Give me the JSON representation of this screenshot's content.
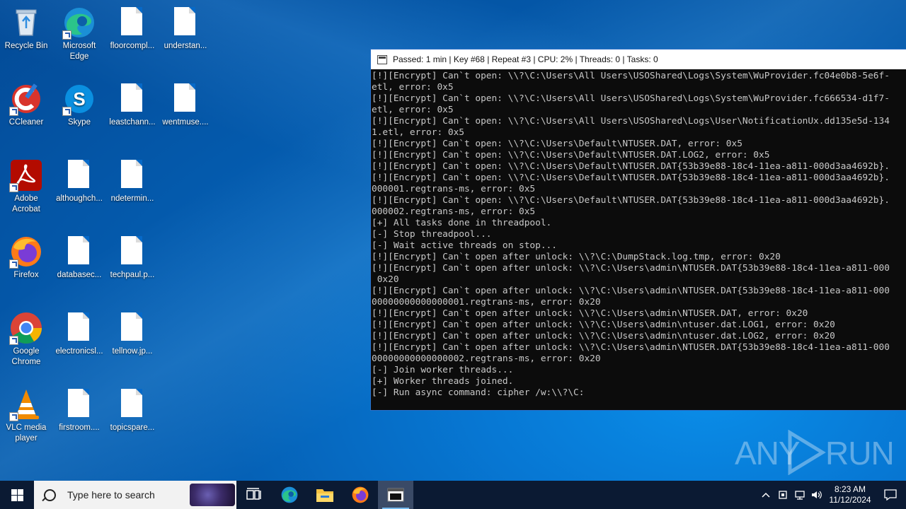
{
  "desktop": {
    "icons": [
      {
        "label": "Recycle Bin"
      },
      {
        "label": "Microsoft Edge"
      },
      {
        "label": "floorcompl..."
      },
      {
        "label": "understan..."
      },
      {
        "label": "CCleaner"
      },
      {
        "label": "Skype"
      },
      {
        "label": "leastchann..."
      },
      {
        "label": "wentmuse...."
      },
      {
        "label": "Adobe Acrobat"
      },
      {
        "label": "althoughch..."
      },
      {
        "label": "ndetermin..."
      },
      {
        "label": "Firefox"
      },
      {
        "label": "databasec..."
      },
      {
        "label": "techpaul.p..."
      },
      {
        "label": "Google Chrome"
      },
      {
        "label": "electronicsl..."
      },
      {
        "label": "tellnow.jp..."
      },
      {
        "label": "VLC media player"
      },
      {
        "label": "firstroom...."
      },
      {
        "label": "topicspare..."
      }
    ]
  },
  "console": {
    "title": "Passed: 1 min | Key #68 | Repeat #3 | CPU: 2% | Threads: 0 | Tasks: 0",
    "lines": [
      "[!][Encrypt] Can`t open: \\\\?\\C:\\Users\\All Users\\USOShared\\Logs\\System\\WuProvider.fc04e0b8-5e6f-",
      "etl, error: 0x5",
      "[!][Encrypt] Can`t open: \\\\?\\C:\\Users\\All Users\\USOShared\\Logs\\System\\WuProvider.fc666534-d1f7-",
      "etl, error: 0x5",
      "[!][Encrypt] Can`t open: \\\\?\\C:\\Users\\All Users\\USOShared\\Logs\\User\\NotificationUx.dd135e5d-134",
      "1.etl, error: 0x5",
      "[!][Encrypt] Can`t open: \\\\?\\C:\\Users\\Default\\NTUSER.DAT, error: 0x5",
      "[!][Encrypt] Can`t open: \\\\?\\C:\\Users\\Default\\NTUSER.DAT.LOG2, error: 0x5",
      "[!][Encrypt] Can`t open: \\\\?\\C:\\Users\\Default\\NTUSER.DAT{53b39e88-18c4-11ea-a811-000d3aa4692b}.",
      "[!][Encrypt] Can`t open: \\\\?\\C:\\Users\\Default\\NTUSER.DAT{53b39e88-18c4-11ea-a811-000d3aa4692b}.",
      "000001.regtrans-ms, error: 0x5",
      "[!][Encrypt] Can`t open: \\\\?\\C:\\Users\\Default\\NTUSER.DAT{53b39e88-18c4-11ea-a811-000d3aa4692b}.",
      "000002.regtrans-ms, error: 0x5",
      "[+] All tasks done in threadpool.",
      "[-] Stop threadpool...",
      "[-] Wait active threads on stop...",
      "[!][Encrypt] Can`t open after unlock: \\\\?\\C:\\DumpStack.log.tmp, error: 0x20",
      "[!][Encrypt] Can`t open after unlock: \\\\?\\C:\\Users\\admin\\NTUSER.DAT{53b39e88-18c4-11ea-a811-000",
      " 0x20",
      "[!][Encrypt] Can`t open after unlock: \\\\?\\C:\\Users\\admin\\NTUSER.DAT{53b39e88-18c4-11ea-a811-000",
      "00000000000000001.regtrans-ms, error: 0x20",
      "[!][Encrypt] Can`t open after unlock: \\\\?\\C:\\Users\\admin\\NTUSER.DAT, error: 0x20",
      "[!][Encrypt] Can`t open after unlock: \\\\?\\C:\\Users\\admin\\ntuser.dat.LOG1, error: 0x20",
      "[!][Encrypt] Can`t open after unlock: \\\\?\\C:\\Users\\admin\\ntuser.dat.LOG2, error: 0x20",
      "[!][Encrypt] Can`t open after unlock: \\\\?\\C:\\Users\\admin\\NTUSER.DAT{53b39e88-18c4-11ea-a811-000",
      "00000000000000002.regtrans-ms, error: 0x20",
      "[-] Join worker threads...",
      "[+] Worker threads joined.",
      "[-] Run async command: cipher /w:\\\\?\\C:"
    ]
  },
  "watermark": {
    "text_left": "ANY",
    "text_right": "RUN"
  },
  "taskbar": {
    "search_placeholder": "Type here to search",
    "clock_time": "8:23 AM",
    "clock_date": "11/12/2024"
  }
}
